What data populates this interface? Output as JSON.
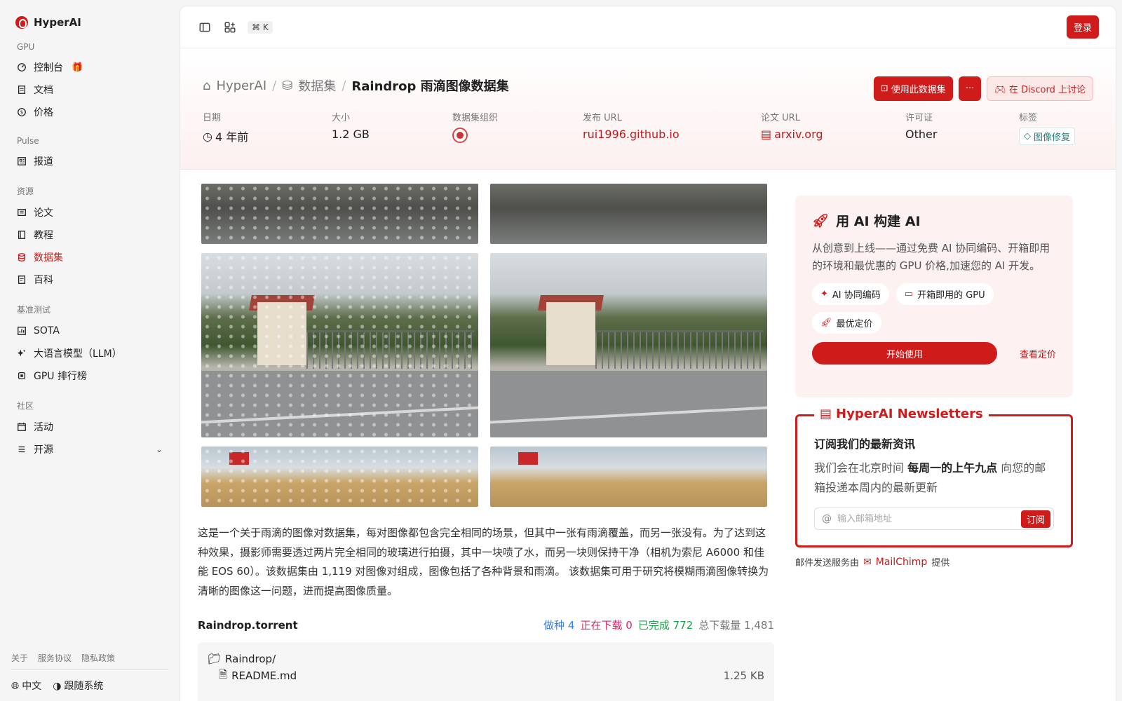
{
  "app": {
    "name": "HyperAI"
  },
  "sidebar": {
    "sections": [
      {
        "label": "GPU",
        "items": [
          {
            "label": "控制台",
            "icon": "gauge-icon",
            "badge": "🎁"
          },
          {
            "label": "文档",
            "icon": "doc-icon"
          },
          {
            "label": "价格",
            "icon": "dollar-icon"
          }
        ]
      },
      {
        "label": "Pulse",
        "items": [
          {
            "label": "报道",
            "icon": "news-icon"
          }
        ]
      },
      {
        "label": "资源",
        "items": [
          {
            "label": "论文",
            "icon": "paper-icon"
          },
          {
            "label": "教程",
            "icon": "book-icon"
          },
          {
            "label": "数据集",
            "icon": "database-icon",
            "active": true
          },
          {
            "label": "百科",
            "icon": "wiki-icon"
          }
        ]
      },
      {
        "label": "基准测试",
        "items": [
          {
            "label": "SOTA",
            "icon": "sota-icon"
          },
          {
            "label": "大语言模型（LLM）",
            "icon": "sparkle-icon"
          },
          {
            "label": "GPU 排行榜",
            "icon": "chip-icon"
          }
        ]
      },
      {
        "label": "社区",
        "items": [
          {
            "label": "活动",
            "icon": "calendar-icon"
          },
          {
            "label": "开源",
            "icon": "list-icon",
            "chevron": true
          }
        ]
      }
    ],
    "footer_links": [
      "关于",
      "服务协议",
      "隐私政策"
    ],
    "language": "中文",
    "theme": "跟随系统"
  },
  "topbar": {
    "shortcut": "⌘ K",
    "login": "登录"
  },
  "breadcrumb": {
    "home": "HyperAI",
    "section": "数据集",
    "current": "Raindrop 雨滴图像数据集"
  },
  "actions": {
    "use_dataset": "使用此数据集",
    "more": "···",
    "discord": "在 Discord 上讨论"
  },
  "meta": {
    "date": {
      "label": "日期",
      "value": "4 年前"
    },
    "size": {
      "label": "大小",
      "value": "1.2 GB"
    },
    "org": {
      "label": "数据集组织"
    },
    "release_url": {
      "label": "发布 URL",
      "value": "rui1996.github.io"
    },
    "paper_url": {
      "label": "论文 URL",
      "value": "arxiv.org"
    },
    "license": {
      "label": "许可证",
      "value": "Other"
    },
    "tags": {
      "label": "标签",
      "value": "图像修复"
    }
  },
  "description": "这是一个关于雨滴的图像对数据集，每对图像都包含完全相同的场景，但其中一张有雨滴覆盖，而另一张没有。为了达到这种效果，摄影师需要透过两片完全相同的玻璃进行拍摄，其中一块喷了水，而另一块则保持干净（相机为索尼 A6000 和佳能 EOS 60）。该数据集由 1,119 对图像对组成，图像包括了各种背景和雨滴。 该数据集可用于研究将模糊雨滴图像转换为清晰的图像这一问题，进而提高图像质量。",
  "torrent": {
    "name": "Raindrop.torrent",
    "seeding_label": "做种",
    "seeding": "4",
    "downloading_label": "正在下载",
    "downloading": "0",
    "completed_label": "已完成",
    "completed": "772",
    "total_label": "总下载量",
    "total": "1,481",
    "files": [
      {
        "name": "Raindrop/",
        "type": "folder",
        "size": ""
      },
      {
        "name": "README.md",
        "type": "file",
        "size": "1.25 KB"
      }
    ]
  },
  "promo": {
    "title": "用 AI 构建 AI",
    "desc": "从创意到上线——通过免费 AI 协同编码、开箱即用的环境和最优惠的 GPU 价格,加速您的 AI 开发。",
    "chips": [
      "AI 协同编码",
      "开箱即用的 GPU",
      "最优定价"
    ],
    "start": "开始使用",
    "pricing": "查看定价"
  },
  "newsletter": {
    "legend": "HyperAI Newsletters",
    "title": "订阅我们的最新资讯",
    "text_before": "我们会在北京时间 ",
    "text_bold": "每周一的上午九点",
    "text_after": " 向您的邮箱投递本周内的最新更新",
    "placeholder": "输入邮箱地址",
    "button": "订阅"
  },
  "mail_note": {
    "before": "邮件发送服务由",
    "provider": "MailChimp",
    "after": "提供"
  },
  "colors": {
    "accent": "#d01b1b",
    "seed": "#2f80ed",
    "downloading": "#e0245e",
    "completed": "#17a34a"
  }
}
